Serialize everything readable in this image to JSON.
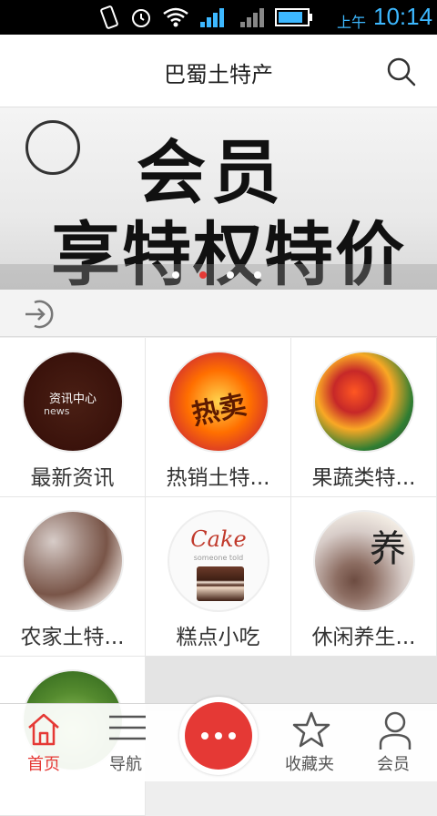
{
  "status": {
    "ampm": "上午",
    "time": "10:14"
  },
  "header": {
    "title": "巴蜀土特产",
    "search_icon": "search-icon"
  },
  "banner": {
    "line1": "会员",
    "line2": "享特权特价",
    "dots": 4,
    "active_dot": 2
  },
  "login": {
    "icon": "login-icon"
  },
  "categories": [
    {
      "label": "最新资讯",
      "image_text": "资讯中心",
      "image_sub": "news"
    },
    {
      "label": "热销土特...",
      "image_text": "热卖"
    },
    {
      "label": "果蔬类特..."
    },
    {
      "label": "农家土特..."
    },
    {
      "label": "糕点小吃",
      "image_text": "Cake",
      "image_sub": "someone told"
    },
    {
      "label": "休闲养生...",
      "image_text": "养"
    },
    {
      "label": ""
    }
  ],
  "tabbar": {
    "items": [
      {
        "label": "首页",
        "icon": "home-icon",
        "active": true
      },
      {
        "label": "导航",
        "icon": "menu-icon"
      },
      {
        "label": "收藏夹",
        "icon": "star-icon"
      },
      {
        "label": "会员",
        "icon": "user-icon"
      }
    ],
    "center_icon": "more-icon"
  },
  "colors": {
    "accent": "#e53935",
    "statusbar_text": "#3db8ff"
  }
}
